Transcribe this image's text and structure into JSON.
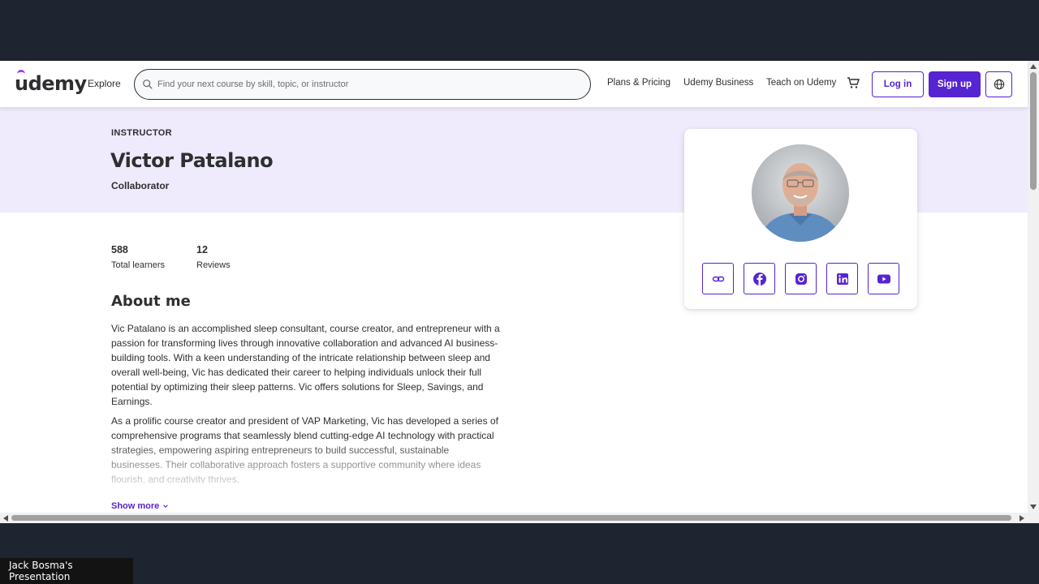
{
  "header": {
    "logo": "udemy",
    "explore": "Explore",
    "search_placeholder": "Find your next course by skill, topic, or instructor",
    "nav": [
      "Plans & Pricing",
      "Udemy Business",
      "Teach on Udemy"
    ],
    "login": "Log in",
    "signup": "Sign up"
  },
  "hero": {
    "label": "INSTRUCTOR",
    "name": "Victor Patalano",
    "role": "Collaborator"
  },
  "stats": [
    {
      "value": "588",
      "label": "Total learners"
    },
    {
      "value": "12",
      "label": "Reviews"
    }
  ],
  "about": {
    "title": "About me",
    "p1": "Vic Patalano is an accomplished sleep consultant, course creator, and entrepreneur with a passion for transforming lives through innovative collaboration and advanced AI business-building tools. With a keen understanding of the intricate relationship between sleep and overall well-being, Vic has dedicated their career to helping individuals unlock their full potential by optimizing their sleep patterns.   Vic offers solutions for Sleep, Savings, and Earnings.",
    "p2": "As a prolific course creator and president of VAP Marketing, Vic has developed a series of comprehensive programs that seamlessly blend cutting-edge AI technology with practical strategies, empowering aspiring entrepreneurs to build successful, sustainable businesses. Their collaborative approach fosters a supportive community where ideas flourish, and creativity thrives.",
    "show_more": "Show more"
  },
  "social_icons": [
    "link-icon",
    "facebook-icon",
    "instagram-icon",
    "linkedin-icon",
    "youtube-icon"
  ],
  "colors": {
    "brand": "#5624d0",
    "hero_bg": "#efeafc",
    "logo_accent": "#a435f0"
  },
  "caption": "Jack Bosma's Presentation"
}
